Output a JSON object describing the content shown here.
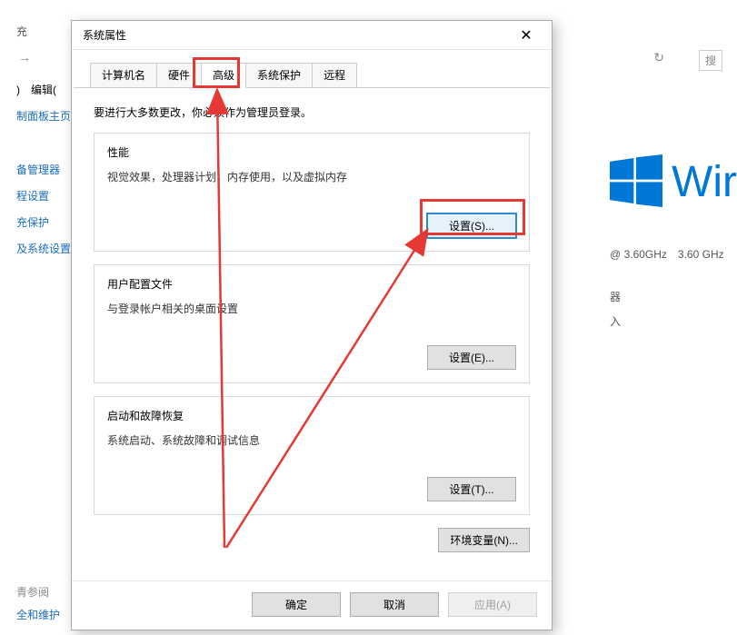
{
  "bg": {
    "frag_title": "充",
    "nav_arrow": "→",
    "refresh_glyph": "↻",
    "search_placeholder": "搜",
    "edit_label": ")　编辑(",
    "panel_main": "制面板主页",
    "left_links": [
      "备管理器",
      "程设置",
      "充保护",
      "及系统设置"
    ],
    "see_also": "青参阅",
    "sec_maint": "全和维护",
    "win_text": "Wir",
    "cpu": "@ 3.60GHz　3.60 GHz",
    "right_frag1": "器",
    "right_frag2": "入"
  },
  "dialog": {
    "title": "系统属性",
    "close_glyph": "✕",
    "tabs": [
      "计算机名",
      "硬件",
      "高级",
      "系统保护",
      "远程"
    ],
    "active_tab_index": 2,
    "admin_note": "要进行大多数更改，你必须作为管理员登录。",
    "groups": {
      "perf": {
        "label": "性能",
        "desc": "视觉效果，处理器计划，内存使用，以及虚拟内存",
        "button": "设置(S)..."
      },
      "profile": {
        "label": "用户配置文件",
        "desc": "与登录帐户相关的桌面设置",
        "button": "设置(E)..."
      },
      "startup": {
        "label": "启动和故障恢复",
        "desc": "系统启动、系统故障和调试信息",
        "button": "设置(T)..."
      }
    },
    "env_button": "环境变量(N)...",
    "ok": "确定",
    "cancel": "取消",
    "apply": "应用(A)"
  },
  "colors": {
    "highlight": "#e53935",
    "win_blue": "#0078d7"
  }
}
